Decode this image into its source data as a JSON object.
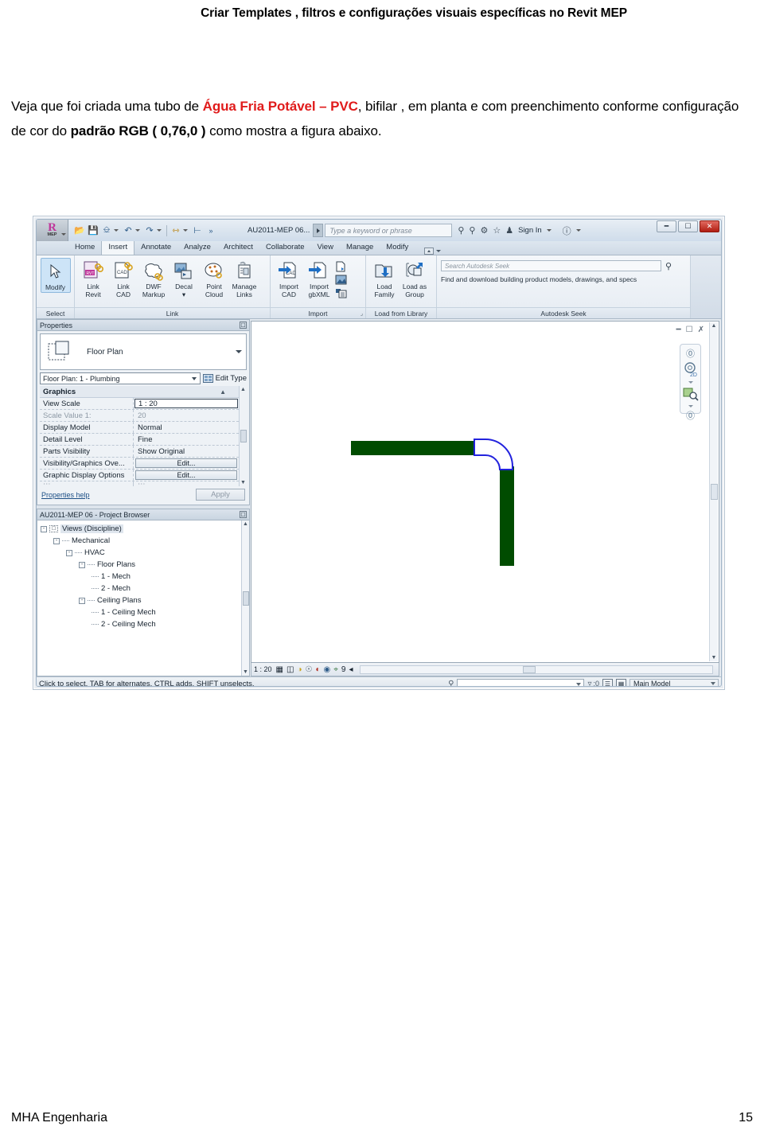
{
  "document": {
    "header_title": "Criar Templates , filtros e configurações visuais específicas no Revit MEP",
    "paragraph": {
      "part1": "Veja que foi criada uma tubo de ",
      "highlight_red": "Água Fria Potável – PVC",
      "part2": ", bifilar , em planta e com preenchimento conforme configuração de cor do ",
      "bold": "padrão RGB ( 0,76,0 )",
      "part3": " como mostra a figura abaixo."
    },
    "footer": {
      "left": "MHA Engenharia",
      "page": "15"
    },
    "colors": {
      "red_accent": "#e01b1b",
      "pipe_green": "#004c00",
      "fitting_blue": "#2222dd"
    }
  },
  "revit": {
    "titlebar": {
      "logo_glyph": "R",
      "logo_sub": "MEP",
      "quick_access": [
        {
          "name": "open-icon",
          "glyph": "▤"
        },
        {
          "name": "save-icon",
          "glyph": "▣"
        },
        {
          "name": "print-icon",
          "glyph": "⬓"
        },
        {
          "name": "undo-icon",
          "glyph": "↶"
        },
        {
          "name": "redo-icon",
          "glyph": "↷"
        },
        {
          "name": "measure-icon",
          "glyph": "⇹"
        },
        {
          "name": "aligned-dimension-icon",
          "glyph": "⊢"
        },
        {
          "name": "overflow-icon",
          "glyph": "»"
        }
      ],
      "document_name": "AU2011-MEP 06...",
      "search_placeholder": "Type a keyword or phrase",
      "infocenter_icons": [
        "search-binocular-icon",
        "subscription-icon",
        "communication-icon",
        "favorites-star-icon"
      ],
      "sign_in": "Sign In",
      "help_label": "?",
      "window_controls": [
        "minimize",
        "restore",
        "close"
      ]
    },
    "tabs": [
      {
        "label": "Home",
        "active": false
      },
      {
        "label": "Insert",
        "active": true
      },
      {
        "label": "Annotate",
        "active": false
      },
      {
        "label": "Analyze",
        "active": false
      },
      {
        "label": "Architect",
        "active": false
      },
      {
        "label": "Collaborate",
        "active": false
      },
      {
        "label": "View",
        "active": false
      },
      {
        "label": "Manage",
        "active": false
      },
      {
        "label": "Modify",
        "active": false
      }
    ],
    "ribbon": {
      "panels": [
        {
          "label": "Select",
          "buttons": [
            {
              "name": "modify-button",
              "line1": "Modify",
              "line2": "",
              "icon": "cursor-arrow-icon",
              "selected": true
            }
          ]
        },
        {
          "label": "Link",
          "buttons": [
            {
              "name": "link-revit-button",
              "line1": "Link",
              "line2": "Revit",
              "icon": "link-revit-icon"
            },
            {
              "name": "link-cad-button",
              "line1": "Link",
              "line2": "CAD",
              "icon": "link-cad-icon"
            },
            {
              "name": "dwf-markup-button",
              "line1": "DWF",
              "line2": "Markup",
              "icon": "dwf-markup-icon"
            },
            {
              "name": "decal-button",
              "line1": "Decal",
              "line2": "▾",
              "icon": "decal-icon"
            },
            {
              "name": "point-cloud-button",
              "line1": "Point",
              "line2": "Cloud",
              "icon": "point-cloud-icon"
            },
            {
              "name": "manage-links-button",
              "line1": "Manage",
              "line2": "Links",
              "icon": "manage-links-icon"
            }
          ]
        },
        {
          "label": "Import",
          "expand": true,
          "buttons": [
            {
              "name": "import-cad-button",
              "line1": "Import",
              "line2": "CAD",
              "icon": "import-cad-icon"
            },
            {
              "name": "import-gbxml-button",
              "line1": "Import",
              "line2": "gbXML",
              "icon": "import-gbxml-icon"
            }
          ],
          "small_buttons": [
            {
              "name": "insert-from-file-icon",
              "glyph": "⇪"
            },
            {
              "name": "image-icon",
              "glyph": "▨"
            },
            {
              "name": "manage-images-icon",
              "glyph": "▤"
            }
          ]
        },
        {
          "label": "Load from Library",
          "buttons": [
            {
              "name": "load-family-button",
              "line1": "Load",
              "line2": "Family",
              "icon": "load-family-icon"
            },
            {
              "name": "load-as-group-button",
              "line1": "Load as",
              "line2": "Group",
              "icon": "load-as-group-icon"
            }
          ]
        },
        {
          "label": "Autodesk Seek",
          "seek_placeholder": "Search Autodesk Seek",
          "seek_description": "Find and download building product models, drawings, and specs"
        }
      ]
    },
    "properties": {
      "panel_title": "Properties",
      "type_preview_label": "Floor Plan",
      "type_selector_value": "Floor Plan: 1 - Plumbing",
      "edit_type_label": "Edit Type",
      "group_label": "Graphics",
      "rows": [
        {
          "key": "View Scale",
          "value": "1 : 20",
          "state": "active"
        },
        {
          "key": "Scale Value    1:",
          "value": "20",
          "state": "dim"
        },
        {
          "key": "Display Model",
          "value": "Normal",
          "state": "normal"
        },
        {
          "key": "Detail Level",
          "value": "Fine",
          "state": "normal"
        },
        {
          "key": "Parts Visibility",
          "value": "Show Original",
          "state": "normal"
        },
        {
          "key": "Visibility/Graphics Ove...",
          "value": "Edit...",
          "state": "button"
        },
        {
          "key": "Graphic Display Options",
          "value": "Edit...",
          "state": "button"
        }
      ],
      "help_link": "Properties help",
      "apply_label": "Apply"
    },
    "project_browser": {
      "panel_title": "AU2011-MEP 06 - Project Browser",
      "tree": [
        {
          "label": "Views (Discipline)",
          "depth": 0,
          "toggle": "-",
          "selected": true,
          "icon": "views-icon"
        },
        {
          "label": "Mechanical",
          "depth": 1,
          "toggle": "-"
        },
        {
          "label": "HVAC",
          "depth": 2,
          "toggle": "-"
        },
        {
          "label": "Floor Plans",
          "depth": 3,
          "toggle": "-"
        },
        {
          "label": "1 - Mech",
          "depth": 4,
          "toggle": ""
        },
        {
          "label": "2 - Mech",
          "depth": 4,
          "toggle": ""
        },
        {
          "label": "Ceiling Plans",
          "depth": 3,
          "toggle": "-"
        },
        {
          "label": "1 - Ceiling Mech",
          "depth": 4,
          "toggle": ""
        },
        {
          "label": "2 - Ceiling Mech",
          "depth": 4,
          "toggle": ""
        }
      ]
    },
    "view_control_bar": {
      "scale": "1 : 20",
      "icons": [
        {
          "name": "scale-grid-icon",
          "glyph": "▩"
        },
        {
          "name": "detail-level-icon",
          "glyph": "◳"
        },
        {
          "name": "visual-style-icon",
          "glyph": "◔"
        },
        {
          "name": "sun-path-icon",
          "glyph": "☼"
        },
        {
          "name": "shadows-icon",
          "glyph": "◐"
        },
        {
          "name": "render-icon",
          "glyph": "◑"
        },
        {
          "name": "crop-view-icon",
          "glyph": "⌗"
        },
        {
          "name": "hide-isolate-icon",
          "glyph": "◇"
        },
        {
          "name": "temporary-hide-icon",
          "glyph": "9"
        },
        {
          "name": "analytical-model-icon",
          "glyph": "◂"
        }
      ]
    },
    "status_bar": {
      "message": "Click to select, TAB for alternates, CTRL adds, SHIFT unselects.",
      "filter_count": ":0",
      "worksets_value": "Main Model",
      "icons": [
        {
          "name": "select-filter-icon",
          "glyph": "⚲"
        },
        {
          "name": "design-options-icon",
          "glyph": "▤"
        },
        {
          "name": "worksets-icon",
          "glyph": "▨"
        }
      ]
    },
    "canvas": {
      "drawing_name": "water-pipe-plan",
      "pipe_color": "#004c00",
      "fitting_outline_color": "#2222dd",
      "navigation": {
        "steering_wheel": "2D",
        "zoom_tool": "zoom-region-icon"
      },
      "window_tools": [
        "minimize-view-icon",
        "restore-view-icon",
        "close-view-icon"
      ]
    }
  }
}
